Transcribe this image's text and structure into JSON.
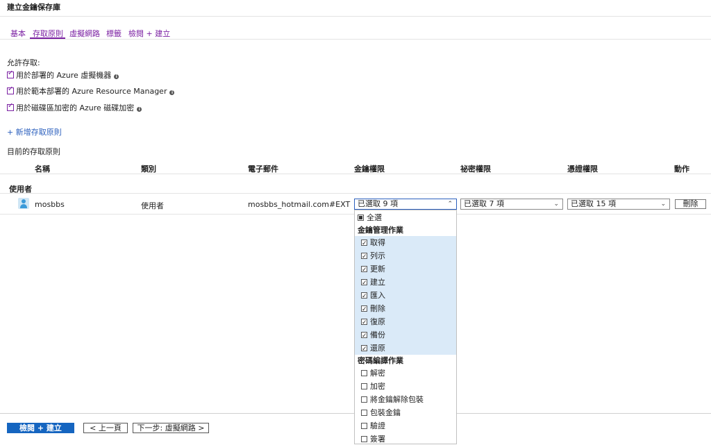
{
  "window": {
    "title": "建立金鑰保存庫"
  },
  "tabs": [
    {
      "label": "基本"
    },
    {
      "label": "存取原則"
    },
    {
      "label": "虛擬網路"
    },
    {
      "label": "標籤"
    },
    {
      "label": "檢閱 + 建立"
    }
  ],
  "access": {
    "heading": "允許存取:",
    "options": [
      {
        "label": "用於部署的 Azure 虛擬機器",
        "checked": true
      },
      {
        "label": "用於範本部署的 Azure Resource Manager",
        "checked": true
      },
      {
        "label": "用於磁碟區加密的 Azure 磁碟加密",
        "checked": true
      }
    ]
  },
  "add_policy": "+ 新增存取原則",
  "policies": {
    "heading": "目前的存取原則",
    "columns": [
      "名稱",
      "類別",
      "電子郵件",
      "金鑰權限",
      "祕密權限",
      "憑證權限",
      "動作"
    ],
    "group": "使用者",
    "row": {
      "name": "mosbbs",
      "category": "使用者",
      "email": "mosbbs_hotmail.com#EXT#@l...",
      "key_perm": "已選取 9 項",
      "secret_perm": "已選取 7 項",
      "cert_perm": "已選取 15 項",
      "action": "刪除"
    }
  },
  "dropdown": {
    "select_all": "全選",
    "group1": "金鑰管理作業",
    "group1_items": [
      {
        "label": "取得",
        "checked": true
      },
      {
        "label": "列示",
        "checked": true
      },
      {
        "label": "更新",
        "checked": true
      },
      {
        "label": "建立",
        "checked": true
      },
      {
        "label": "匯入",
        "checked": true
      },
      {
        "label": "刪除",
        "checked": true
      },
      {
        "label": "復原",
        "checked": true
      },
      {
        "label": "備份",
        "checked": true
      },
      {
        "label": "還原",
        "checked": true
      }
    ],
    "group2": "密碼編譯作業",
    "group2_items": [
      {
        "label": "解密",
        "checked": false
      },
      {
        "label": "加密",
        "checked": false
      },
      {
        "label": "將金鑰解除包裝",
        "checked": false
      },
      {
        "label": "包裝金鑰",
        "checked": false
      },
      {
        "label": "驗證",
        "checked": false
      },
      {
        "label": "簽署",
        "checked": false
      }
    ]
  },
  "footer": {
    "review": "檢閱 + 建立",
    "prev": "< 上一頁",
    "next": "下一步: 虛擬網路 >"
  },
  "colors": {
    "accent": "#7a1fa2",
    "primary": "#1565c0",
    "link": "#2b5fbd",
    "selected_bg": "#daeaf8"
  }
}
